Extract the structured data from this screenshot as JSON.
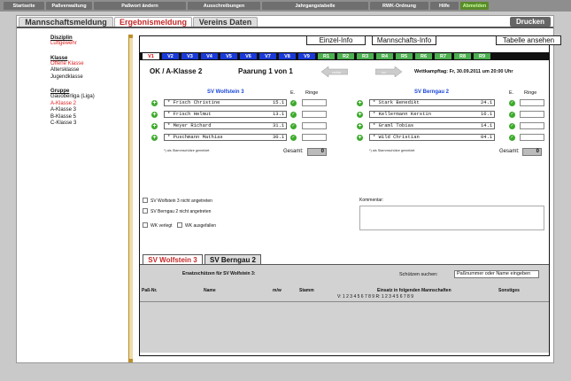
{
  "topnav": [
    "Startseite",
    "Paßverwaltung",
    "Paßwort ändern",
    "Ausschreibungen",
    "Jahrgangstabelle",
    "RWK-Ordnung",
    "Hilfe",
    "Abmelden"
  ],
  "main_tabs": [
    "Mannschaftsmeldung",
    "Ergebnismeldung",
    "Vereins Daten"
  ],
  "print_label": "Drucken",
  "sidebar": {
    "discipline_title": "Disziplin",
    "discipline": "Luftgewehr",
    "class_title": "Klasse",
    "classes": [
      "Offene Klasse",
      "Altersklasse",
      "Jugendklasse"
    ],
    "group_title": "Gruppe",
    "groups": [
      "Gauoberliga (Liga)",
      "A-Klasse 2",
      "A-Klasse 3",
      "B-Klasse 5",
      "C-Klasse 3"
    ]
  },
  "buttons": {
    "einzel": "Einzel-Info",
    "mannschaft": "Mannschafts-Info",
    "tabelle": "Tabelle ansehen"
  },
  "rounds": [
    "V1",
    "V2",
    "V3",
    "V4",
    "V5",
    "V6",
    "V7",
    "V8",
    "V9",
    "R1",
    "R2",
    "R3",
    "R4",
    "R5",
    "R6",
    "R7",
    "R8",
    "R9"
  ],
  "match": {
    "league": "OK / A-Klasse 2",
    "pairing": "Paarung 1 von 1",
    "arrow_prev": "zurück",
    "arrow_next": "vor",
    "date": "Wettkampftag: Fr, 30.09.2011 um 20:00 Uhr"
  },
  "home": {
    "name": "SV Wolfstein 3",
    "players": [
      [
        "* Frisch Christine",
        "15.1"
      ],
      [
        "* Frisch Helmut",
        "13.1"
      ],
      [
        "* Meyer Richard",
        "31.1"
      ],
      [
        "* Puschmann Mathias",
        "30.1"
      ]
    ],
    "gesamt": "0"
  },
  "away": {
    "name": "SV Berngau 2",
    "players": [
      [
        "* Stark Benedikt",
        "24.1"
      ],
      [
        "* Kellermann Kerstin",
        "16.1"
      ],
      [
        "* Graml Tobias",
        "14.1"
      ],
      [
        "* Wild Christian",
        "04.1"
      ]
    ],
    "gesamt": "0"
  },
  "col_e": "E.",
  "col_ringe": "Ringe",
  "note": "*) als Stammschütze gemeldet",
  "gesamt_label": "Gesamt:",
  "checkboxes": {
    "home_absent": "SV Wolfstein 3 nicht angetreten",
    "away_absent": "SV Berngau 2 nicht angetreten",
    "postponed": "WK verlegt",
    "cancelled": "WK ausgefallen"
  },
  "comment_label": "Kommentar:",
  "bottom_tabs": [
    "SV Wolfstein 3",
    "SV Berngau 2"
  ],
  "ersatz": {
    "title": "Ersatzschützen für SV Wolfstein 3:",
    "search_label": "Schützen suchen:",
    "search_placeholder": "Paßnummer oder Name eingeben",
    "cols": {
      "pass": "Paß-Nr.",
      "name": "Name",
      "mw": "m/w",
      "stamm": "Stamm",
      "einsatz": "Einsatz in folgenden Mannschaften",
      "sonstiges": "Sonstiges"
    },
    "sub": "V: 1 2 3 4 5 6 7 8 9     R: 1 2 3 4 5 6 7 8 9"
  }
}
